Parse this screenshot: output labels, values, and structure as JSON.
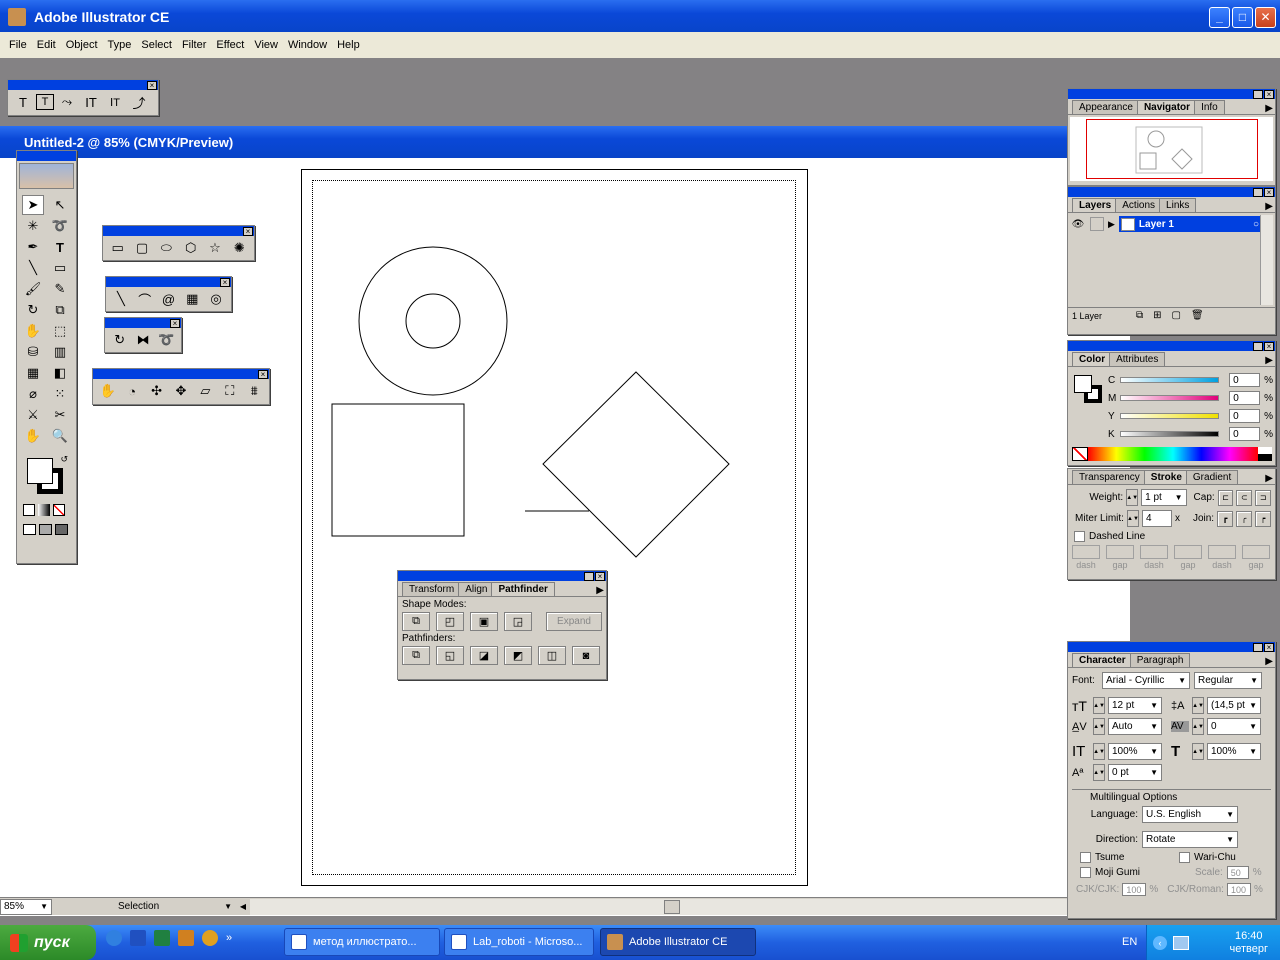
{
  "app": {
    "title": "Adobe Illustrator CE"
  },
  "menu": [
    "File",
    "Edit",
    "Object",
    "Type",
    "Select",
    "Filter",
    "Effect",
    "View",
    "Window",
    "Help"
  ],
  "document": {
    "title": "Untitled-2 @ 85% (CMYK/Preview)"
  },
  "type_toolbar": {
    "icons": [
      "type-icon",
      "area-type-icon",
      "path-type-icon",
      "vertical-type-icon",
      "vertical-area-type-icon",
      "vertical-path-type-icon"
    ]
  },
  "navigator": {
    "tabs": [
      "Appearance",
      "Navigator",
      "Info"
    ]
  },
  "layers": {
    "tabs": [
      "Layers",
      "Actions",
      "Links"
    ],
    "layer_name": "Layer 1",
    "count": "1 Layer"
  },
  "color": {
    "tabs": [
      "Color",
      "Attributes"
    ],
    "channels": [
      {
        "label": "C",
        "value": "0",
        "unit": "%",
        "color": "#00a0e0"
      },
      {
        "label": "M",
        "value": "0",
        "unit": "%",
        "color": "#e0007a"
      },
      {
        "label": "Y",
        "value": "0",
        "unit": "%",
        "color": "#f0e000"
      },
      {
        "label": "K",
        "value": "0",
        "unit": "%",
        "color": "#000000"
      }
    ]
  },
  "stroke": {
    "tabs": [
      "Transparency",
      "Stroke",
      "Gradient"
    ],
    "weight_label": "Weight:",
    "weight": "1 pt",
    "cap_label": "Cap:",
    "miter_label": "Miter Limit:",
    "miter": "4",
    "miter_unit": "x",
    "join_label": "Join:",
    "dashed_label": "Dashed Line",
    "dash_labels": [
      "dash",
      "gap",
      "dash",
      "gap",
      "dash",
      "gap"
    ]
  },
  "pathfinder": {
    "tabs": [
      "Transform",
      "Align",
      "Pathfinder"
    ],
    "shape_modes_label": "Shape Modes:",
    "expand_label": "Expand",
    "pathfinders_label": "Pathfinders:"
  },
  "character": {
    "tabs": [
      "Character",
      "Paragraph"
    ],
    "font_label": "Font:",
    "font": "Arial - Cyrillic",
    "style": "Regular",
    "size": "12 pt",
    "leading": "(14,5 pt",
    "kerning": "Auto",
    "tracking": "0",
    "vscale": "100%",
    "hscale": "100%",
    "baseline": "0 pt",
    "multilingual_label": "Multilingual Options",
    "language_label": "Language:",
    "language": "U.S. English",
    "direction_label": "Direction:",
    "direction": "Rotate",
    "tsume": "Tsume",
    "warichu": "Wari-Chu",
    "mojigumi": "Moji Gumi",
    "scale_label": "Scale:",
    "scale": "50",
    "scale_unit": "%",
    "cjkcjk_label": "CJK/CJK:",
    "cjkcjk": "100",
    "cjkroman_label": "CJK/Roman:",
    "cjkroman": "100",
    "pct": "%"
  },
  "status": {
    "zoom": "85%",
    "mode": "Selection"
  },
  "taskbar": {
    "start": "пуск",
    "items": [
      "метод иллюстрато...",
      "Lab_roboti - Microso...",
      "Adobe Illustrator CE"
    ],
    "lang": "EN",
    "time": "16:40",
    "day": "четверг",
    "chevron": "»"
  }
}
